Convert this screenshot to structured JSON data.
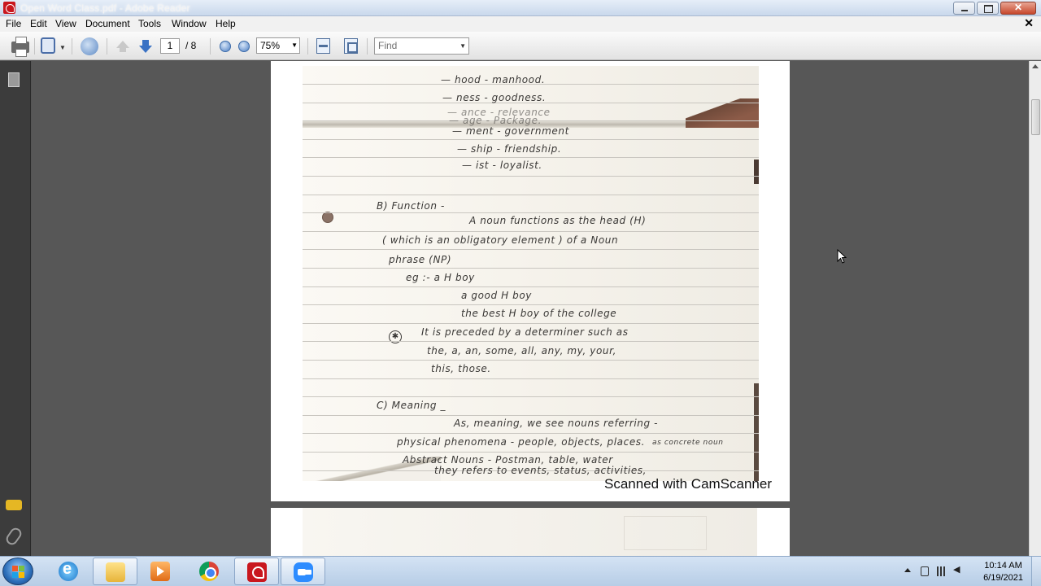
{
  "window": {
    "title": "Open Word Class.pdf - Adobe Reader"
  },
  "menu": {
    "items": [
      "File",
      "Edit",
      "View",
      "Document",
      "Tools",
      "Window",
      "Help"
    ]
  },
  "toolbar": {
    "current_page": "1",
    "page_total": "/ 8",
    "zoom": "75%",
    "find_placeholder": "Find",
    "icons": [
      "print-icon",
      "save-icon",
      "share-icon",
      "prev-page-icon",
      "next-page-icon",
      "zoom-out-icon",
      "zoom-in-icon",
      "fit-width-icon",
      "fit-page-icon"
    ]
  },
  "document": {
    "handwriting_lines": [
      "— hood  -   manhood.",
      "— ness  -   goodness.",
      "— ance  -   relevance",
      "— age  -   Package.",
      "— ment  -   government",
      "— ship  -   friendship.",
      "— ist   -   loyalist.",
      "B)   Function  -",
      "A  noun  functions  as  the  head  (H)",
      "( which  is  an  obligatory  element )  of  a  Noun",
      "phrase  (NP)",
      "eg :-    a H boy",
      "a  good H boy",
      "the  best H boy  of  the  college",
      "It  is  preceded  by  a  determiner  such as",
      "the,  a,  an,  some,  all,  any,  my,  your,",
      "this,  those.",
      "C)   Meaning  _",
      "As,  meaning,  we  see  nouns  referring  -",
      "physical  phenomena  -  people,  objects,  places.",
      "as concrete noun",
      "Abstract  Nouns  -   Postman,  table,  water",
      "they  refers  to  events,  status,  activities,"
    ],
    "watermark": "Scanned with CamScanner"
  },
  "taskbar": {
    "apps": [
      "internet-explorer",
      "file-explorer",
      "media-player",
      "chrome",
      "adobe-reader",
      "zoom"
    ],
    "time": "10:14 AM",
    "date": "6/19/2021"
  }
}
